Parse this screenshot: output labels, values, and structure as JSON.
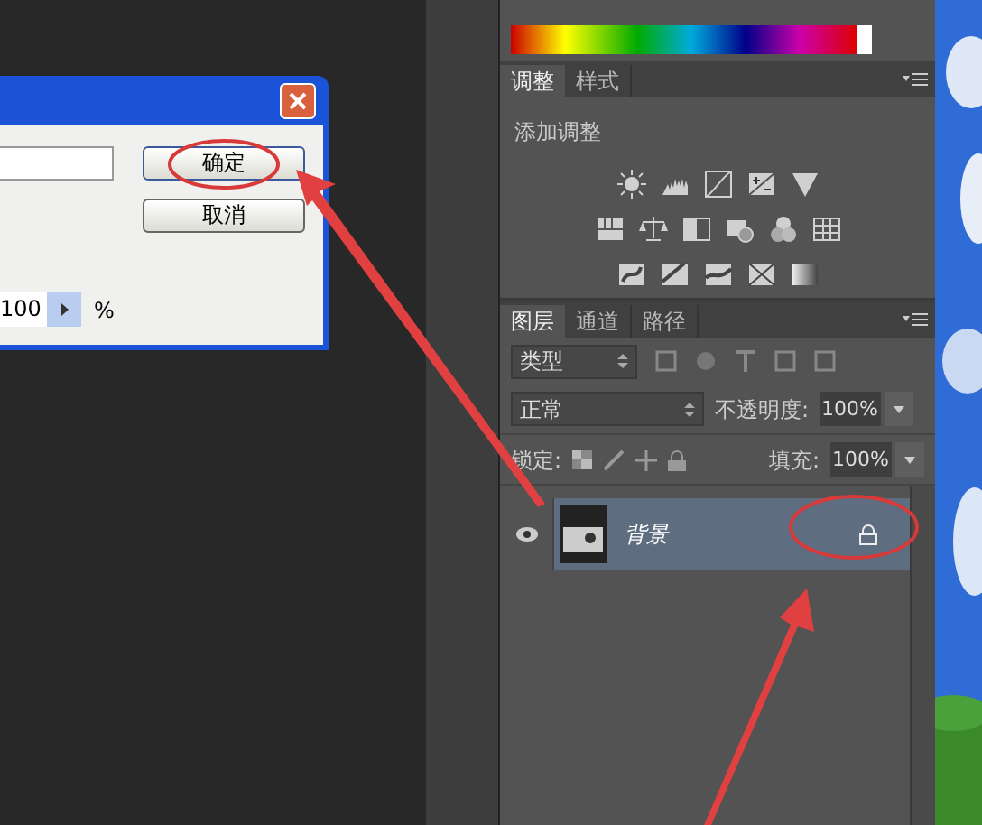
{
  "dialog": {
    "buttons": [
      {
        "label": "确定",
        "highlighted": true
      },
      {
        "label": "取消",
        "highlighted": false
      }
    ],
    "amount": {
      "value": "100",
      "unit": "%"
    }
  },
  "adjustments": {
    "tabs": [
      {
        "label": "调整",
        "selected": true
      },
      {
        "label": "样式",
        "selected": false
      }
    ],
    "heading": "添加调整"
  },
  "layers": {
    "tabs": [
      {
        "label": "图层",
        "selected": true
      },
      {
        "label": "通道",
        "selected": false
      },
      {
        "label": "路径",
        "selected": false
      }
    ],
    "filter": "类型",
    "blend_mode": "正常",
    "opacity_label": "不透明度:",
    "opacity": "100%",
    "lock_label": "锁定:",
    "fill_label": "填充:",
    "fill": "100%",
    "items": [
      {
        "name": "背景",
        "visible": true,
        "locked": true,
        "selected": true
      }
    ]
  }
}
